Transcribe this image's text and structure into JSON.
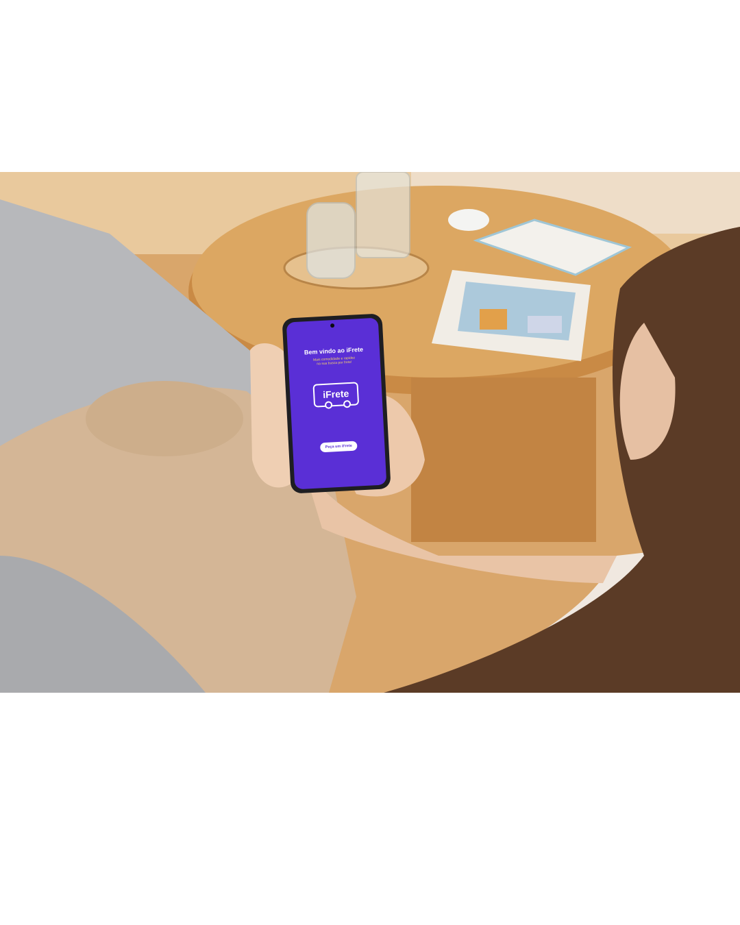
{
  "scene": {
    "description_colors": {
      "screen_purple": "#5a2fd6",
      "screen_purple_dark": "#4a22c2",
      "subtitle_yellow": "#f2d06b",
      "table_wood": "#d9a35c",
      "sofa_gray": "#b9babd",
      "pants_beige": "#d2b595",
      "hair_brown": "#5a3a26"
    }
  },
  "app_screen": {
    "title": "Bem vindo ao iFrete",
    "subtitle_line1": "Mais comodidade e rapidez",
    "subtitle_line2": "na sua busca por frete!",
    "logo_text": "iFrete",
    "cta_label": "Peça um iFrete"
  }
}
